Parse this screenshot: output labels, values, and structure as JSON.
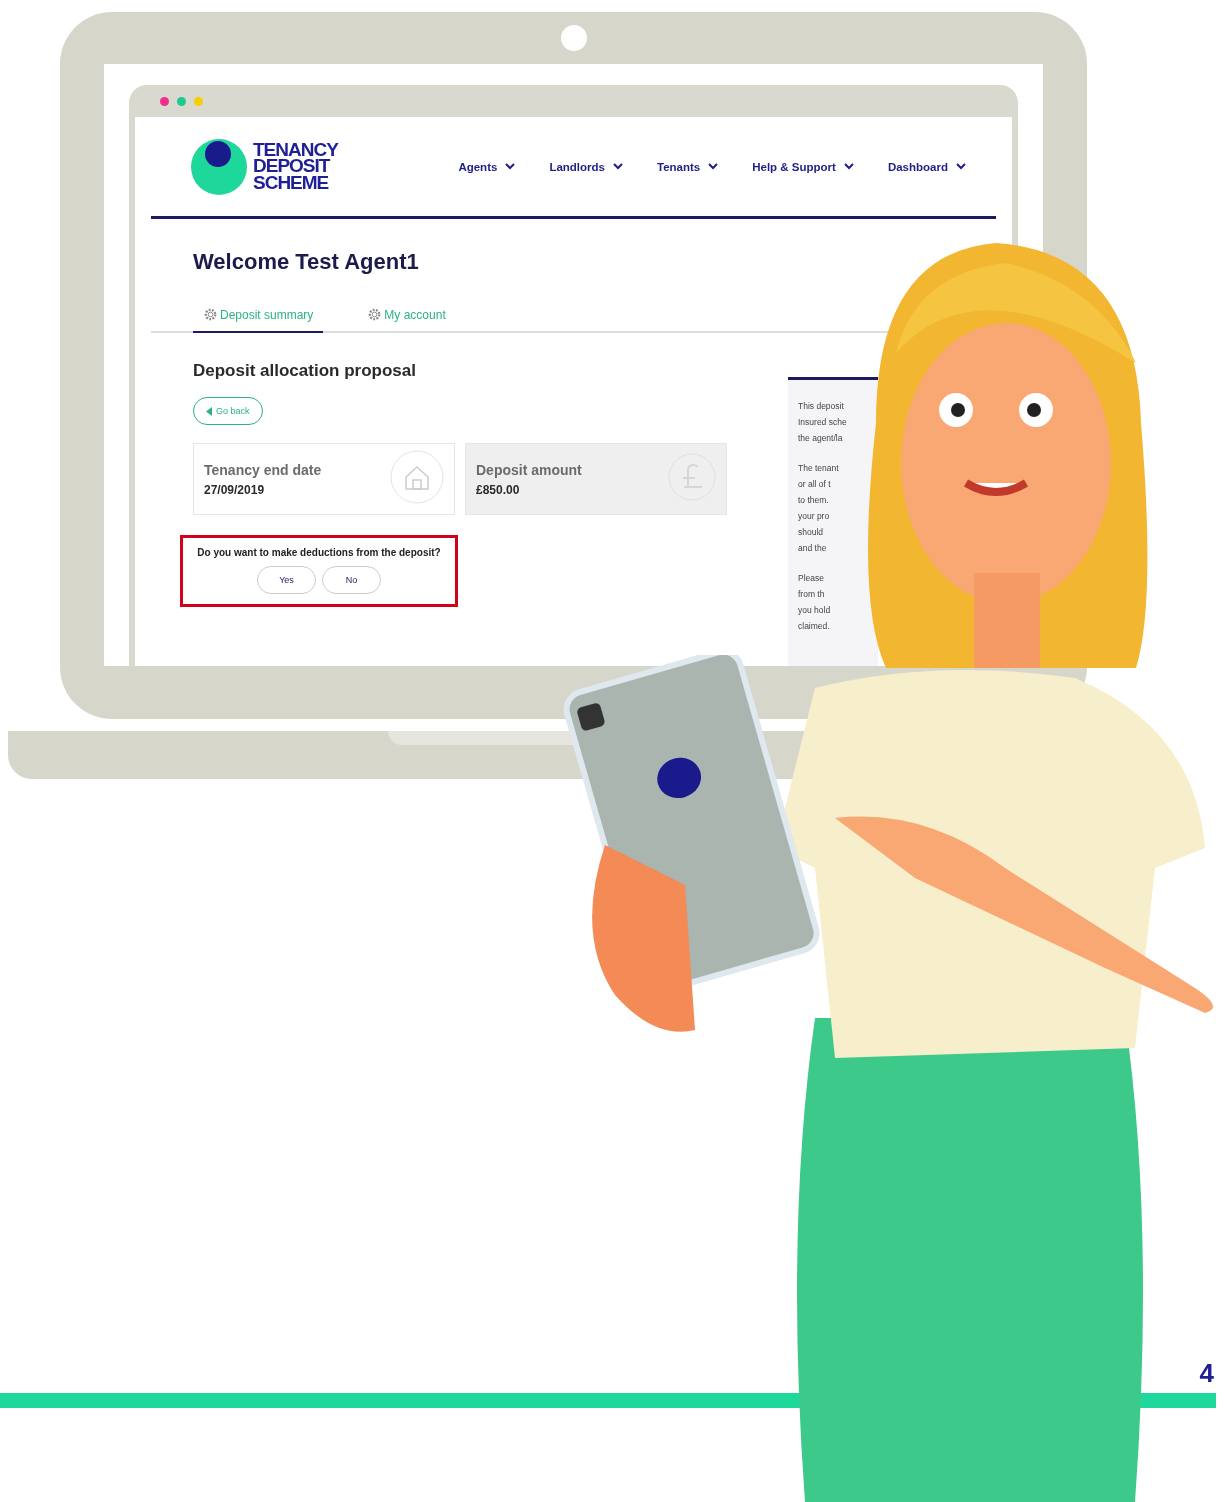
{
  "browser": {
    "dots": [
      {
        "color": "#f0308f"
      },
      {
        "color": "#1ec98f"
      },
      {
        "color": "#f5d000"
      }
    ]
  },
  "logo": {
    "lines": [
      "TENANCY",
      "DEPOSIT",
      "SCHEME"
    ]
  },
  "nav": [
    {
      "label": "Agents"
    },
    {
      "label": "Landlords"
    },
    {
      "label": "Tenants"
    },
    {
      "label": "Help & Support"
    },
    {
      "label": "Dashboard"
    }
  ],
  "welcome": "Welcome Test Agent1",
  "tabs": [
    {
      "label": "Deposit summary",
      "selected": true
    },
    {
      "label": "My account",
      "selected": false
    }
  ],
  "section_title": "Deposit allocation proposal",
  "back_button": "Go back",
  "cards": [
    {
      "kind": "house",
      "title": "Tenancy end date",
      "value": "27/09/2019"
    },
    {
      "kind": "pound",
      "title": "Deposit amount",
      "value": "£850.00"
    }
  ],
  "question": {
    "text": "Do you want to make deductions from the deposit?",
    "options": [
      {
        "label": "Yes"
      },
      {
        "label": "No"
      }
    ]
  },
  "sidebar": {
    "paragraphs": [
      {
        "lines": [
          "This deposit",
          "Insured sche",
          "the agent/la"
        ]
      },
      {
        "lines": [
          "The tenant",
          "or all of t",
          "to them.",
          "your pro",
          "should",
          "and the"
        ]
      },
      {
        "lines": [
          "Please",
          "from th",
          "you hold",
          "claimed."
        ]
      }
    ]
  },
  "page_number": "4"
}
